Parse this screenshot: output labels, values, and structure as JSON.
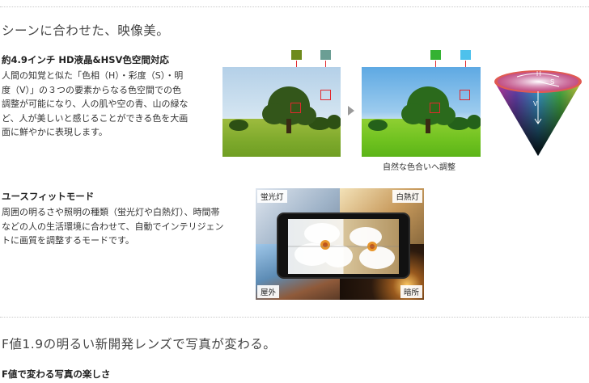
{
  "section1": {
    "title": "シーンに合わせた、映像美。",
    "feature1": {
      "heading": "約4.9インチ HD液晶&HSV色空間対応",
      "lines": [
        "人間の知覚と似た「色相（H）・彩度（S）・明",
        "度（V）」の３つの要素からなる色空間での色",
        "調整が可能になり、人の肌や空の青、山の緑な",
        "ど、人が美しいと感じることができる色を大画",
        "面に鮮やかに表現します。"
      ],
      "caption": "自然な色合いへ調整",
      "cone_labels": {
        "h": "H",
        "s": "S",
        "v": "V"
      },
      "swatch_colors": {
        "before_left": "#6e8a1c",
        "before_right": "#6b9e94",
        "after_left": "#34b233",
        "after_right": "#4ec1ec"
      }
    },
    "feature2": {
      "heading": "ユースフィットモード",
      "lines": [
        "周囲の明るさや照明の種類（蛍光灯や白熱灯）、時間帯",
        "などの人の生活環境に合わせて、自動でインテリジェン",
        "トに画質を調整するモードです。"
      ],
      "labels": {
        "top_left": "蛍光灯",
        "top_right": "白熱灯",
        "bottom_left": "屋外",
        "bottom_right": "暗所"
      }
    }
  },
  "section2": {
    "title": "F値1.9の明るい新開発レンズで写真が変わる。",
    "subheading": "F値で変わる写真の楽しさ"
  }
}
